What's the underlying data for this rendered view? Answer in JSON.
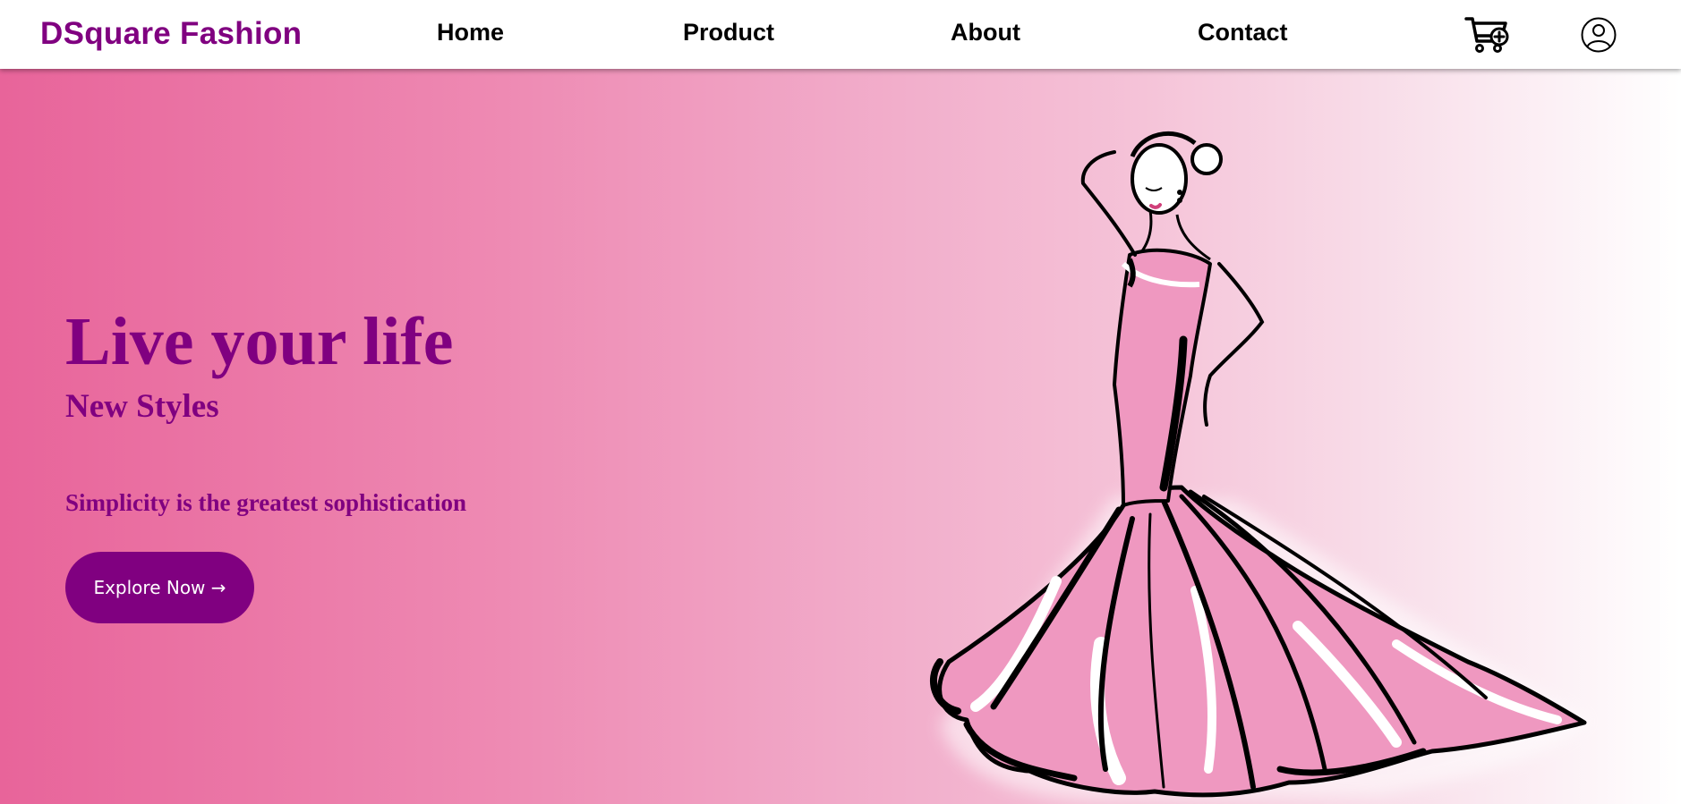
{
  "nav": {
    "brand": "DSquare Fashion",
    "links": [
      "Home",
      "Product",
      "About",
      "Contact"
    ]
  },
  "icons": {
    "cart": "cart-plus-icon",
    "user": "user-circle-icon"
  },
  "hero": {
    "headline": "Live your life",
    "subheadline": "New Styles",
    "tagline": "Simplicity is the greatest sophistication",
    "cta_label": "Explore Now →"
  },
  "colors": {
    "brand": "#800080",
    "hero_gradient_start": "#e8649a",
    "hero_gradient_end": "#ffffff",
    "dress": "#ef98c0"
  }
}
